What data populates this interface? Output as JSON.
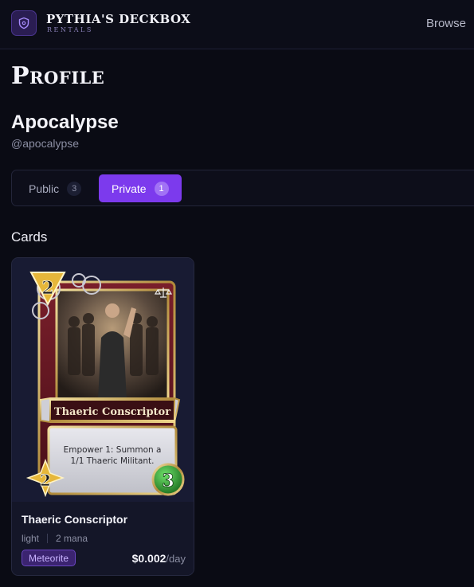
{
  "header": {
    "brand_name": "PYTHIA'S DECKBOX",
    "brand_sub": "RENTALS",
    "nav_browse": "Browse",
    "logo_icon": "shield-icon"
  },
  "page": {
    "title": "Profile"
  },
  "user": {
    "name": "Apocalypse",
    "handle": "@apocalypse"
  },
  "tabs": [
    {
      "label": "Public",
      "count": "3",
      "active": false
    },
    {
      "label": "Private",
      "count": "1",
      "active": true
    }
  ],
  "cards_section": {
    "title": "Cards"
  },
  "cards": [
    {
      "art": {
        "banner_name": "Thaeric Conscriptor",
        "ability_line1": "Empower 1: Summon a",
        "ability_line2": "1/1 Thaeric Militant.",
        "cost": "2",
        "attack": "2",
        "health": "3",
        "faction_icon": "scales-icon"
      },
      "name": "Thaeric Conscriptor",
      "faction": "light",
      "mana": "2 mana",
      "rarity": "Meteorite",
      "price": "$0.002",
      "price_unit": "/day"
    }
  ],
  "colors": {
    "accent": "#7c3aed",
    "background": "#0a0b14",
    "rarity_badge": "#3b2470"
  }
}
